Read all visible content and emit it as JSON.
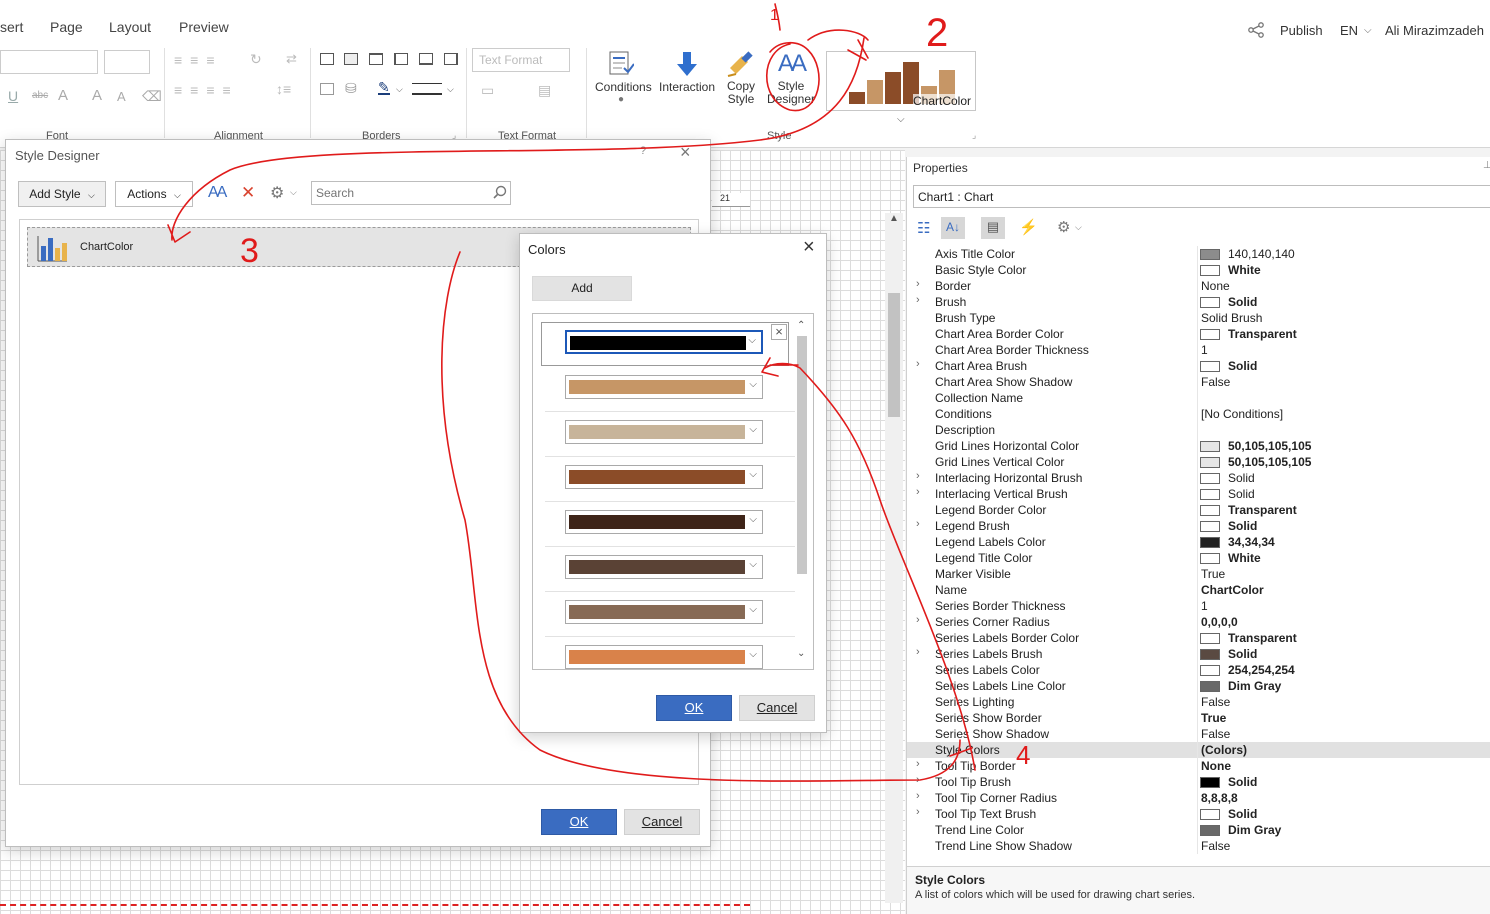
{
  "menu": {
    "tabs": [
      "sert",
      "Page",
      "Layout",
      "Preview"
    ]
  },
  "top_right": {
    "publish": "Publish",
    "language": "EN",
    "user": "Ali Mirazimzadeh"
  },
  "ribbon": {
    "groups": {
      "font": "Font",
      "alignment": "Alignment",
      "borders": "Borders",
      "text_format": "Text Format",
      "style": "Style"
    },
    "text_format_select": "Text Format",
    "buttons": {
      "conditions": "Conditions",
      "interaction": "Interaction",
      "copy_style_1": "Copy",
      "copy_style_2": "Style",
      "style_designer_1": "Style",
      "style_designer_2": "Designer",
      "chartcolor": "ChartColor"
    }
  },
  "style_designer": {
    "title": "Style Designer",
    "add_style": "Add Style",
    "actions": "Actions",
    "search_placeholder": "Search",
    "item_name": "ChartColor",
    "ok": "OK",
    "cancel": "Cancel"
  },
  "colors_dialog": {
    "title": "Colors",
    "add": "Add",
    "ok": "OK",
    "cancel": "Cancel",
    "colors": [
      "#000000",
      "#c69666",
      "#c7b49a",
      "#8b4c28",
      "#3e2418",
      "#5a4235",
      "#876a55",
      "#d9824a"
    ]
  },
  "ruler": {
    "mark": "21"
  },
  "properties": {
    "title": "Properties",
    "selector": "Chart1 : Chart",
    "rows": [
      {
        "name": "Axis Title Color",
        "value": "140,140,140",
        "swatch": "#8c8c8c",
        "expand": false,
        "bold": false
      },
      {
        "name": "Basic Style Color",
        "value": "White",
        "swatch": "#ffffff",
        "expand": false,
        "bold": true
      },
      {
        "name": "Border",
        "value": "None",
        "swatch": null,
        "expand": true,
        "bold": false
      },
      {
        "name": "Brush",
        "value": "Solid",
        "swatch": "#ffffff",
        "expand": true,
        "bold": true
      },
      {
        "name": "Brush Type",
        "value": "Solid Brush",
        "swatch": null,
        "expand": false,
        "bold": false
      },
      {
        "name": "Chart Area Border Color",
        "value": "Transparent",
        "swatch": "#ffffff",
        "expand": false,
        "bold": true
      },
      {
        "name": "Chart Area Border Thickness",
        "value": "1",
        "swatch": null,
        "expand": false,
        "bold": false
      },
      {
        "name": "Chart Area Brush",
        "value": "Solid",
        "swatch": "#ffffff",
        "expand": true,
        "bold": true
      },
      {
        "name": "Chart Area Show Shadow",
        "value": "False",
        "swatch": null,
        "expand": false,
        "bold": false
      },
      {
        "name": "Collection Name",
        "value": "",
        "swatch": null,
        "expand": false,
        "bold": false
      },
      {
        "name": "Conditions",
        "value": "[No Conditions]",
        "swatch": null,
        "expand": false,
        "bold": false
      },
      {
        "name": "Description",
        "value": "",
        "swatch": null,
        "expand": false,
        "bold": false
      },
      {
        "name": "Grid Lines Horizontal Color",
        "value": "50,105,105,105",
        "swatch": "#e6e6e6",
        "expand": false,
        "bold": true
      },
      {
        "name": "Grid Lines Vertical Color",
        "value": "50,105,105,105",
        "swatch": "#e6e6e6",
        "expand": false,
        "bold": true
      },
      {
        "name": "Interlacing Horizontal Brush",
        "value": "Solid",
        "swatch": "#ffffff",
        "expand": true,
        "bold": false
      },
      {
        "name": "Interlacing Vertical Brush",
        "value": "Solid",
        "swatch": "#ffffff",
        "expand": true,
        "bold": false
      },
      {
        "name": "Legend Border Color",
        "value": "Transparent",
        "swatch": "#ffffff",
        "expand": false,
        "bold": true
      },
      {
        "name": "Legend Brush",
        "value": "Solid",
        "swatch": "#ffffff",
        "expand": true,
        "bold": true
      },
      {
        "name": "Legend Labels Color",
        "value": "34,34,34",
        "swatch": "#222222",
        "expand": false,
        "bold": true
      },
      {
        "name": "Legend Title Color",
        "value": "White",
        "swatch": "#ffffff",
        "expand": false,
        "bold": true
      },
      {
        "name": "Marker Visible",
        "value": "True",
        "swatch": null,
        "expand": false,
        "bold": false
      },
      {
        "name": "Name",
        "value": "ChartColor",
        "swatch": null,
        "expand": false,
        "bold": true
      },
      {
        "name": "Series Border Thickness",
        "value": "1",
        "swatch": null,
        "expand": false,
        "bold": false
      },
      {
        "name": "Series Corner Radius",
        "value": "0,0,0,0",
        "swatch": null,
        "expand": true,
        "bold": true
      },
      {
        "name": "Series Labels Border Color",
        "value": "Transparent",
        "swatch": "#ffffff",
        "expand": false,
        "bold": true
      },
      {
        "name": "Series Labels Brush",
        "value": "Solid",
        "swatch": "#5a4a42",
        "expand": true,
        "bold": true
      },
      {
        "name": "Series Labels Color",
        "value": "254,254,254",
        "swatch": "#fefefe",
        "expand": false,
        "bold": true
      },
      {
        "name": "Series Labels Line Color",
        "value": "Dim Gray",
        "swatch": "#696969",
        "expand": false,
        "bold": true
      },
      {
        "name": "Series Lighting",
        "value": "False",
        "swatch": null,
        "expand": false,
        "bold": false
      },
      {
        "name": "Series Show Border",
        "value": "True",
        "swatch": null,
        "expand": false,
        "bold": true
      },
      {
        "name": "Series Show Shadow",
        "value": "False",
        "swatch": null,
        "expand": false,
        "bold": false
      },
      {
        "name": "Style Colors",
        "value": "(Colors)",
        "swatch": null,
        "expand": false,
        "bold": true,
        "selected": true
      },
      {
        "name": "Tool Tip Border",
        "value": "None",
        "swatch": null,
        "expand": true,
        "bold": true
      },
      {
        "name": "Tool Tip Brush",
        "value": "Solid",
        "swatch": "#000000",
        "expand": true,
        "bold": true
      },
      {
        "name": "Tool Tip Corner Radius",
        "value": "8,8,8,8",
        "swatch": null,
        "expand": true,
        "bold": true
      },
      {
        "name": "Tool Tip Text Brush",
        "value": "Solid",
        "swatch": "#ffffff",
        "expand": true,
        "bold": true
      },
      {
        "name": "Trend Line Color",
        "value": "Dim Gray",
        "swatch": "#696969",
        "expand": false,
        "bold": true
      },
      {
        "name": "Trend Line Show Shadow",
        "value": "False",
        "swatch": null,
        "expand": false,
        "bold": false
      }
    ],
    "description_title": "Style Colors",
    "description_text": "A list of colors which will be used for drawing chart series."
  },
  "annotations": {
    "one": "1",
    "two": "2",
    "three": "3",
    "four": "4"
  },
  "accent_colors": {
    "primary": "#3a6cc1",
    "annotation": "#e01b1b"
  }
}
